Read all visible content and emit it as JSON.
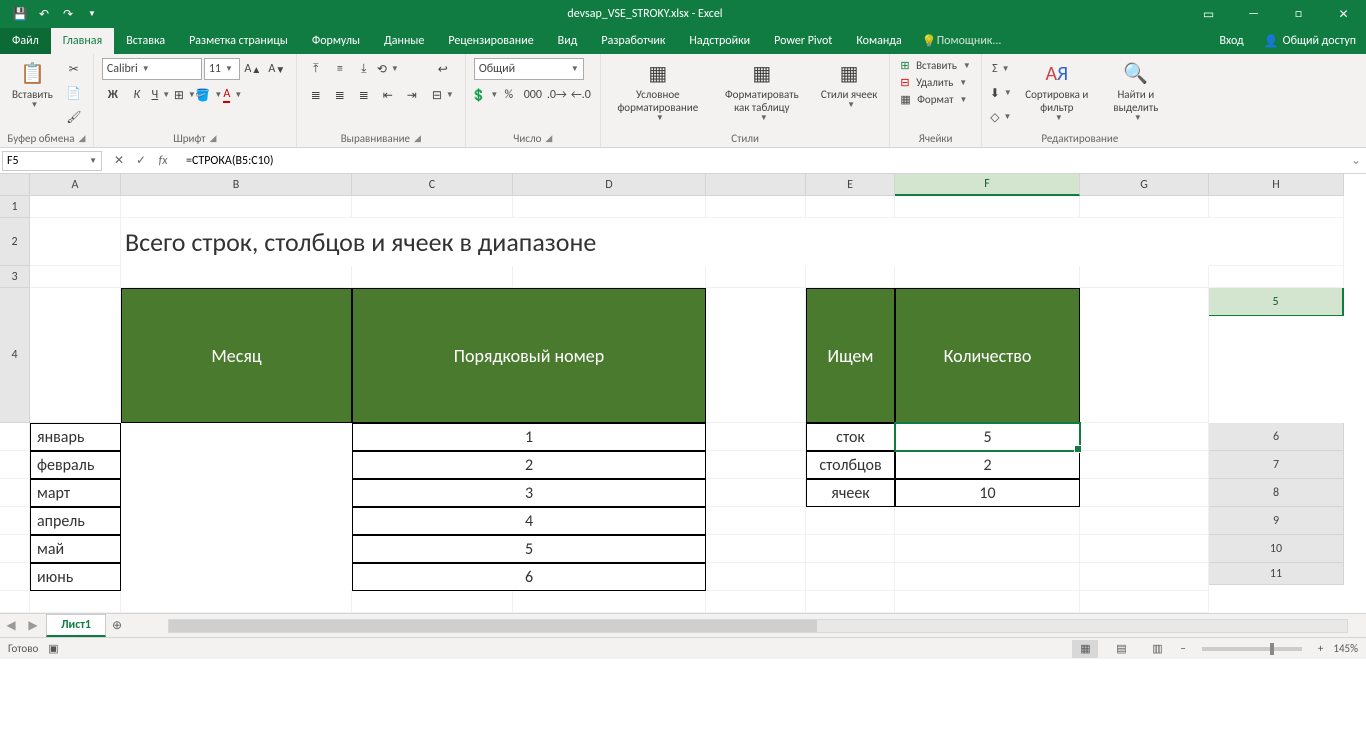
{
  "titlebar": {
    "filename": "devsap_VSE_STROKY.xlsx - Excel"
  },
  "tabs": {
    "file": "Файл",
    "home": "Главная",
    "insert": "Вставка",
    "pagelayout": "Разметка страницы",
    "formulas": "Формулы",
    "data": "Данные",
    "review": "Рецензирование",
    "view": "Вид",
    "developer": "Разработчик",
    "addins": "Надстройки",
    "powerpivot": "Power Pivot",
    "team": "Команда",
    "tellme": "Помощник...",
    "signin": "Вход",
    "share": "Общий доступ"
  },
  "ribbon": {
    "paste": "Вставить",
    "clipboard": "Буфер обмена",
    "font_name": "Calibri",
    "font_size": "11",
    "font_group": "Шрифт",
    "align_group": "Выравнивание",
    "number_format": "Общий",
    "number_group": "Число",
    "cond_format": "Условное форматирование",
    "format_table": "Форматировать как таблицу",
    "cell_styles": "Стили ячеек",
    "styles_group": "Стили",
    "insert_row": "Вставить",
    "delete_row": "Удалить",
    "format": "Формат",
    "cells_group": "Ячейки",
    "sort_filter": "Сортировка и фильтр",
    "find_select": "Найти и выделить",
    "editing_group": "Редактирование"
  },
  "formula_bar": {
    "cell_ref": "F5",
    "formula": "=СТРОКА(B5:C10)"
  },
  "columns": [
    "A",
    "B",
    "C",
    "D",
    "E",
    "F",
    "G",
    "H"
  ],
  "rows": [
    "1",
    "2",
    "3",
    "4",
    "5",
    "6",
    "7",
    "8",
    "9",
    "10",
    "11"
  ],
  "sheet": {
    "title": "Всего строк, столбцов и ячеек в диапазоне",
    "table1_headers": [
      "Месяц",
      "Порядковый номер"
    ],
    "table1_rows": [
      [
        "январь",
        "1"
      ],
      [
        "февраль",
        "2"
      ],
      [
        "март",
        "3"
      ],
      [
        "апрель",
        "4"
      ],
      [
        "май",
        "5"
      ],
      [
        "июнь",
        "6"
      ]
    ],
    "table2_headers": [
      "Ищем",
      "Количество"
    ],
    "table2_rows": [
      [
        "сток",
        "5"
      ],
      [
        "столбцов",
        "2"
      ],
      [
        "ячеек",
        "10"
      ]
    ]
  },
  "sheet_tabs": {
    "active": "Лист1"
  },
  "status": {
    "ready": "Готово",
    "zoom": "145%"
  }
}
